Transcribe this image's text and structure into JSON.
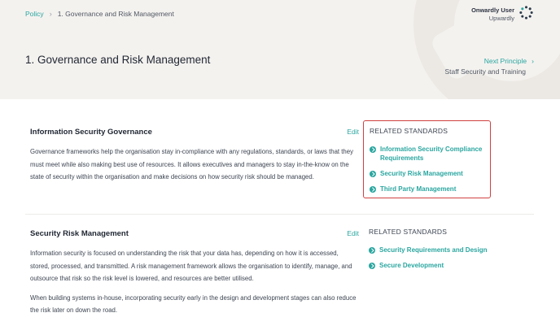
{
  "breadcrumb": {
    "root": "Policy",
    "current": "1. Governance and Risk Management"
  },
  "user": {
    "name": "Onwardly User",
    "org": "Upwardly"
  },
  "page": {
    "title": "1. Governance and Risk Management"
  },
  "next_principle": {
    "label": "Next Principle",
    "title": "Staff Security and Training"
  },
  "sections": [
    {
      "title": "Information Security Governance",
      "edit_label": "Edit",
      "paragraphs": [
        "Governance frameworks help the organisation stay in-compliance with any regulations, standards, or laws that they must meet while also making best use of resources. It allows executives and managers to stay in-the-know on the state of security within the organisation and make decisions on how security risk should be managed."
      ],
      "related_title": "RELATED STANDARDS",
      "related": [
        "Information Security Compliance Requirements",
        "Security Risk Management",
        "Third Party Management"
      ]
    },
    {
      "title": "Security Risk Management",
      "edit_label": "Edit",
      "paragraphs": [
        "Information security is focused on understanding the risk that your data has, depending on how it is accessed, stored, processed, and transmitted. A risk management framework allows the organisation to identify, manage, and outsource that risk so the risk level is lowered, and resources are better utilised.",
        "When building systems in-house, incorporating security early in the design and development stages can also reduce the risk later on down the road."
      ],
      "related_title": "RELATED STANDARDS",
      "related": [
        "Security Requirements and Design",
        "Secure Development"
      ]
    }
  ],
  "colors": {
    "accent": "#2aa6a0",
    "header_bg": "#f4f2ef",
    "highlight_border": "#d04040"
  }
}
